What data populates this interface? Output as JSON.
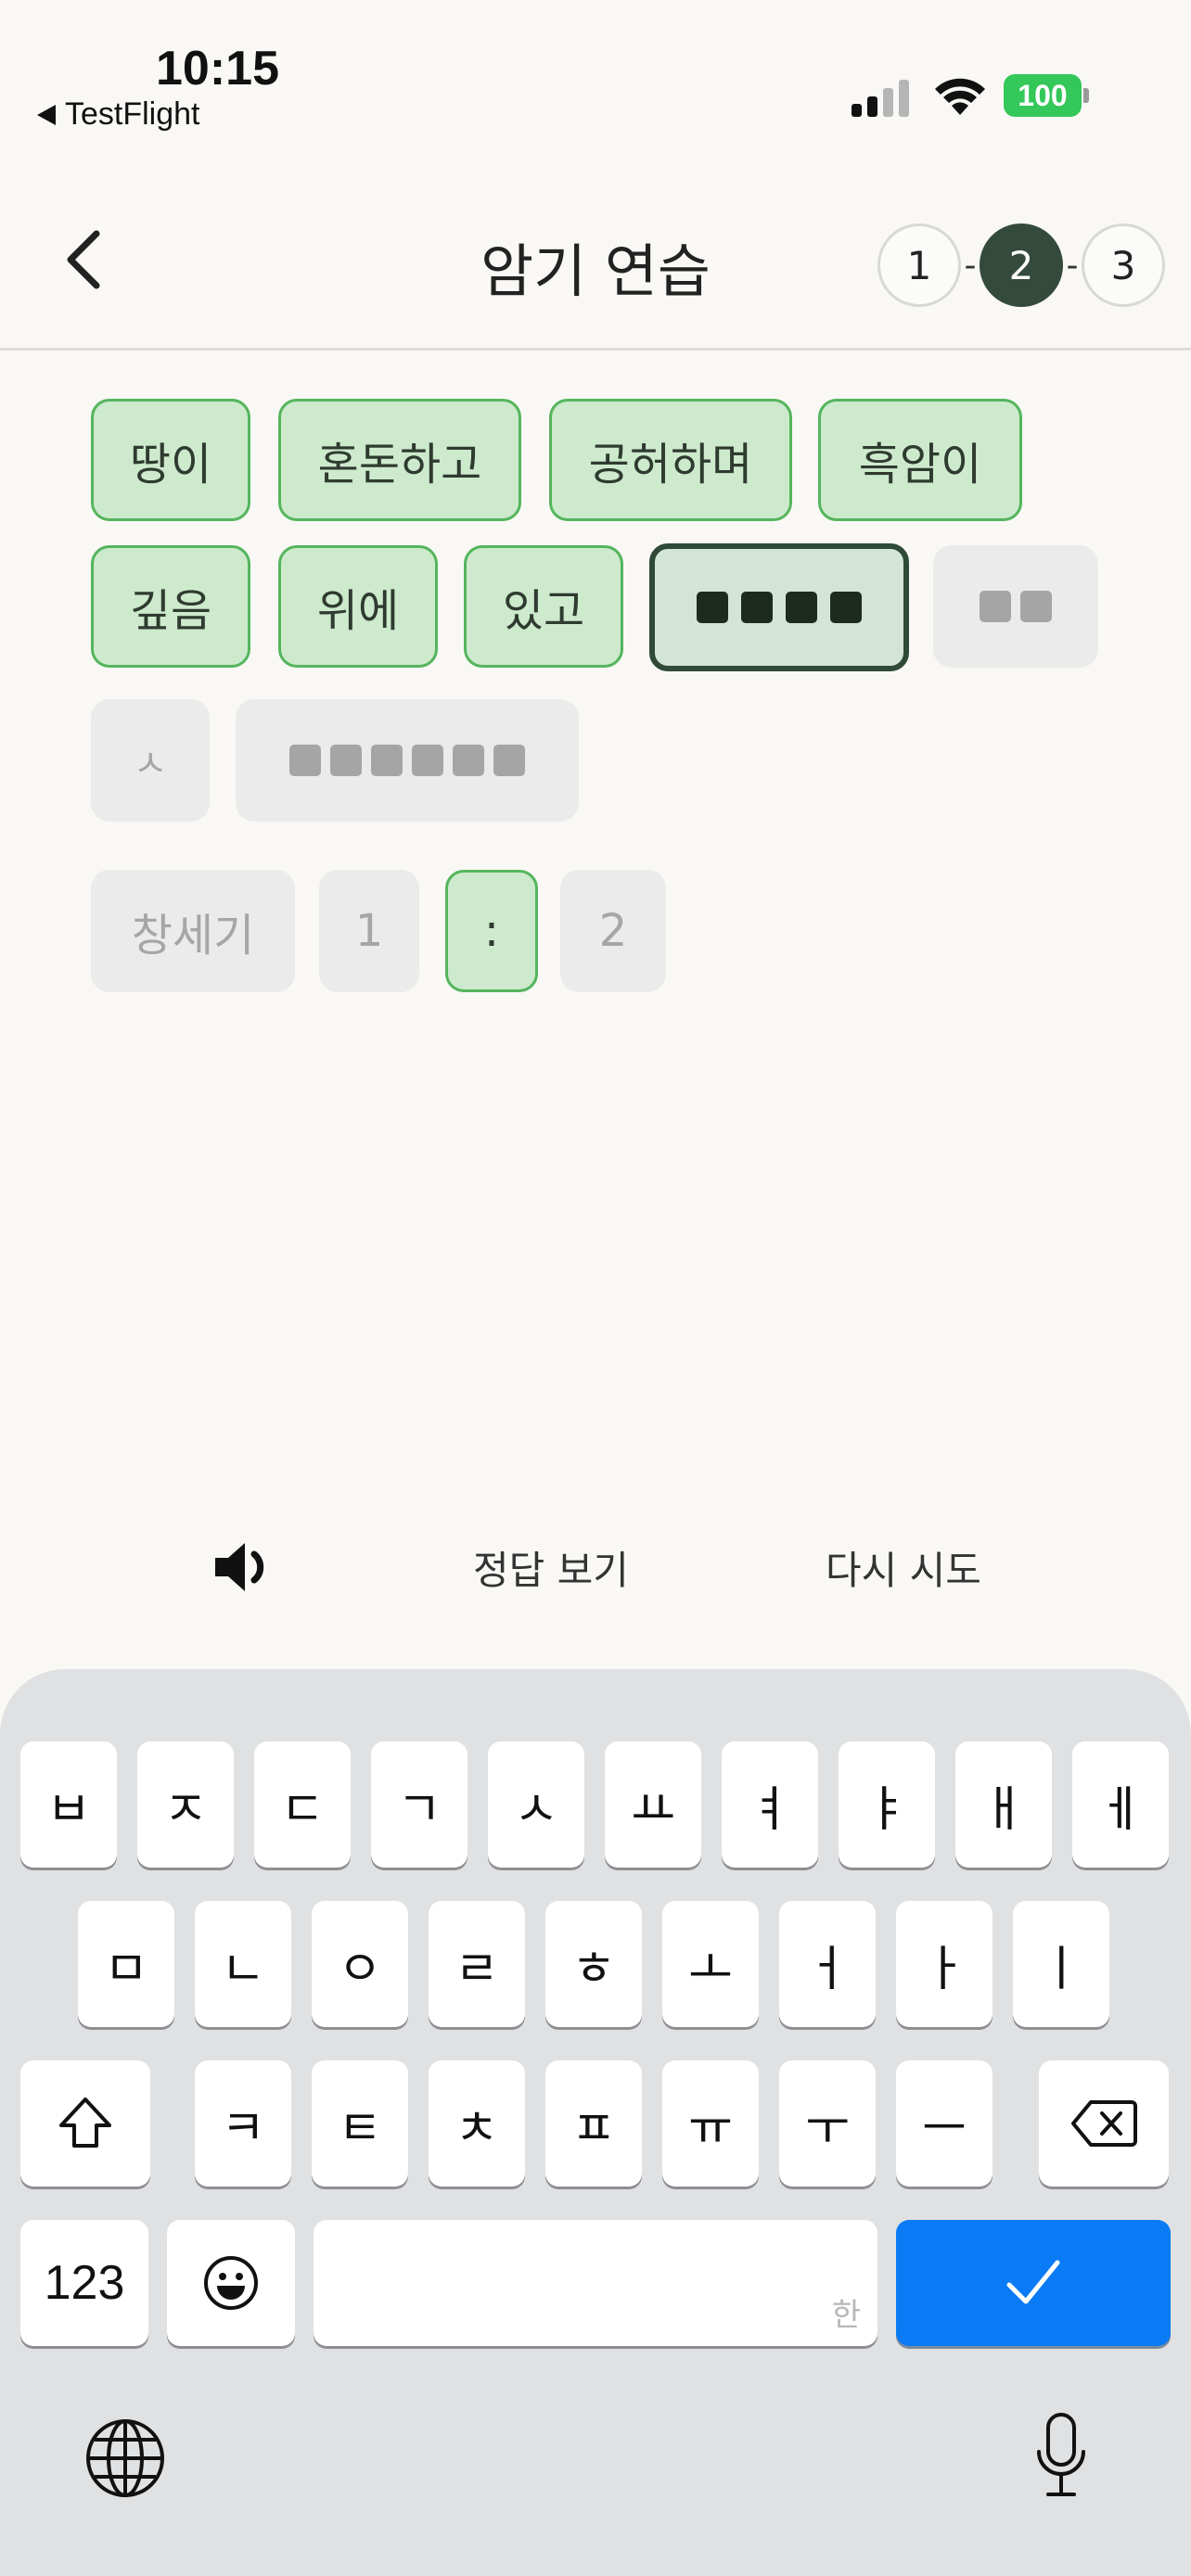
{
  "status": {
    "time": "10:15",
    "back_app": "TestFlight",
    "battery": "100"
  },
  "nav": {
    "title": "암기 연습",
    "steps": [
      "1",
      "2",
      "3"
    ],
    "active_step": "2"
  },
  "words": {
    "done": [
      "땅이",
      "혼돈하고",
      "공허하며",
      "흑암이",
      "깊음",
      "위에",
      "있고"
    ],
    "hint": "ㅅ",
    "reference_book": "창세기",
    "chapter": "1",
    "separator": ":",
    "verse": "2"
  },
  "actions": {
    "answer": "정답 보기",
    "retry": "다시 시도"
  },
  "keyboard": {
    "row1": [
      "ㅂ",
      "ㅈ",
      "ㄷ",
      "ㄱ",
      "ㅅ",
      "ㅛ",
      "ㅕ",
      "ㅑ",
      "ㅐ",
      "ㅔ"
    ],
    "row2": [
      "ㅁ",
      "ㄴ",
      "ㅇ",
      "ㄹ",
      "ㅎ",
      "ㅗ",
      "ㅓ",
      "ㅏ",
      "ㅣ"
    ],
    "row3": [
      "ㅋ",
      "ㅌ",
      "ㅊ",
      "ㅍ",
      "ㅠ",
      "ㅜ",
      "ㅡ"
    ],
    "numbers": "123",
    "space_hint": "한",
    "accent": "#0a7bf5"
  }
}
